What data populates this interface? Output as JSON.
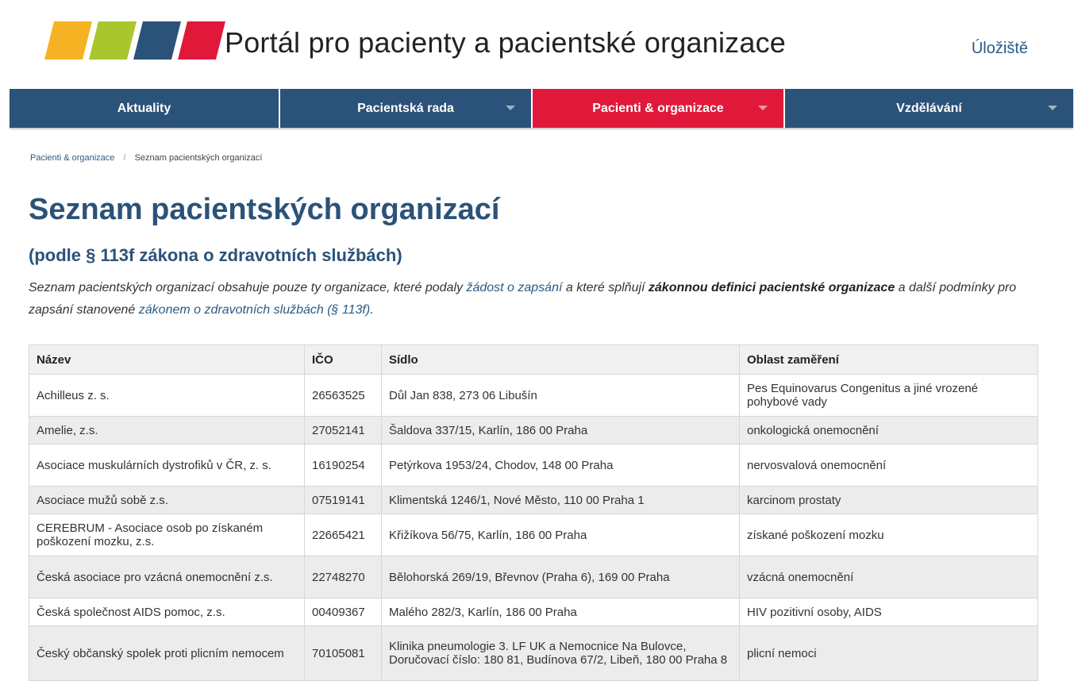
{
  "header": {
    "site_title": "Portál pro pacienty a pacientské organizace",
    "storage_link": "Úložiště",
    "logo_colors": [
      "#f5b323",
      "#a9c62c",
      "#2b5279",
      "#e0193a"
    ]
  },
  "nav": {
    "items": [
      {
        "label": "Aktuality",
        "dropdown": false,
        "active": false
      },
      {
        "label": "Pacientská rada",
        "dropdown": true,
        "active": false
      },
      {
        "label": "Pacienti & organizace",
        "dropdown": true,
        "active": true
      },
      {
        "label": "Vzdělávání",
        "dropdown": true,
        "active": false
      }
    ]
  },
  "breadcrumb": {
    "parent": "Pacienti & organizace",
    "separator": "/",
    "current": "Seznam pacientských organizací"
  },
  "page": {
    "title": "Seznam pacientských organizací",
    "subtitle": "(podle § 113f zákona o zdravotních službách)",
    "intro": {
      "part1": "Seznam pacientských organizací obsahuje pouze ty organizace, které podaly ",
      "link1": "žádost o zapsání",
      "part2": " a které splňují ",
      "bold": "zákonnou definici pacientské organizace",
      "part3": " a další podmínky pro zapsání stanovené ",
      "link2": "zákonem o zdravotních službách (§ 113f)",
      "part4": "."
    }
  },
  "table": {
    "headers": [
      "Název",
      "IČO",
      "Sídlo",
      "Oblast zaměření"
    ],
    "rows": [
      [
        "Achilleus z. s.",
        "26563525",
        "Důl Jan 838, 273 06 Libušín",
        "Pes Equinovarus Congenitus a jiné vrozené pohybové vady"
      ],
      [
        "Amelie, z.s.",
        "27052141",
        "Šaldova 337/15, Karlín, 186 00 Praha",
        "onkologická onemocnění"
      ],
      [
        "Asociace muskulárních dystrofiků v ČR, z. s.",
        "16190254",
        "Petýrkova 1953/24, Chodov, 148 00 Praha",
        "nervosvalová onemocnění"
      ],
      [
        "Asociace mužů sobě z.s.",
        "07519141",
        "Klimentská 1246/1, Nové Město, 110 00 Praha 1",
        "karcinom prostaty"
      ],
      [
        "CEREBRUM - Asociace osob po získaném poškození mozku, z.s.",
        "22665421",
        "Křižíkova 56/75, Karlín, 186 00 Praha",
        "získané poškození mozku"
      ],
      [
        "Česká asociace pro vzácná onemocnění z.s.",
        "22748270",
        "Bělohorská 269/19, Břevnov (Praha 6), 169 00 Praha",
        "vzácná onemocnění"
      ],
      [
        "Česká společnost AIDS pomoc, z.s.",
        "00409367",
        "Malého 282/3, Karlín, 186 00 Praha",
        "HIV pozitivní osoby, AIDS"
      ],
      [
        "Český občanský spolek proti plicním nemocem",
        "70105081",
        "Klinika pneumologie 3. LF UK a Nemocnice Na Bulovce, Doručovací číslo: 180 81, Budínova 67/2, Libeň, 180 00 Praha 8",
        "plicní nemoci"
      ]
    ]
  }
}
